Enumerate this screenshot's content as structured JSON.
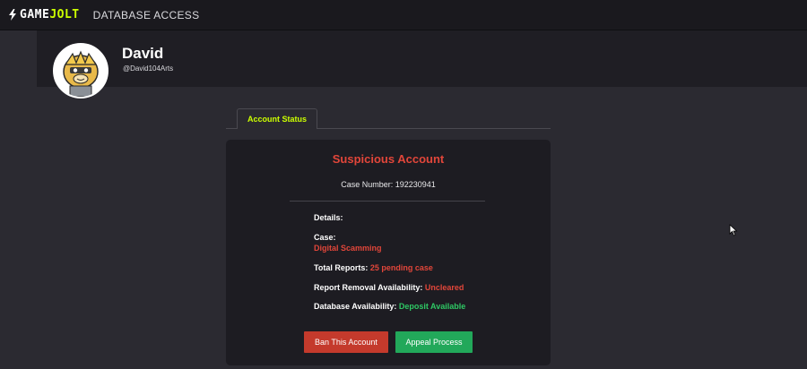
{
  "topbar": {
    "logo_word1": "GAME",
    "logo_word2": "JOLT",
    "nav_label": "DATABASE ACCESS"
  },
  "profile": {
    "name": "David",
    "handle": "@David104Arts"
  },
  "tabs": [
    {
      "label": "Account Status",
      "active": true
    }
  ],
  "status": {
    "title": "Suspicious Account",
    "case_number": "Case Number: 192230941",
    "details_label": "Details:",
    "case_label": "Case:",
    "case_value": "Digital Scamming",
    "reports_label": "Total Reports:",
    "reports_value": "25 pending case",
    "removal_label": "Report Removal Availability:",
    "removal_value": "Uncleared",
    "db_label": "Database Availability:",
    "db_value": "Deposit Available"
  },
  "actions": {
    "ban_label": "Ban This Account",
    "appeal_label": "Appeal Process"
  },
  "colors": {
    "accent_lime": "#ccff00",
    "danger_red": "#e2463a",
    "success_green": "#2ec864",
    "ban_button": "#c43a2c",
    "appeal_button": "#22a85a",
    "background": "#2b2a31",
    "card": "#1d1c22"
  },
  "icons": {
    "logo": "lightning-bolt-icon",
    "cursor": "mouse-pointer-icon"
  }
}
